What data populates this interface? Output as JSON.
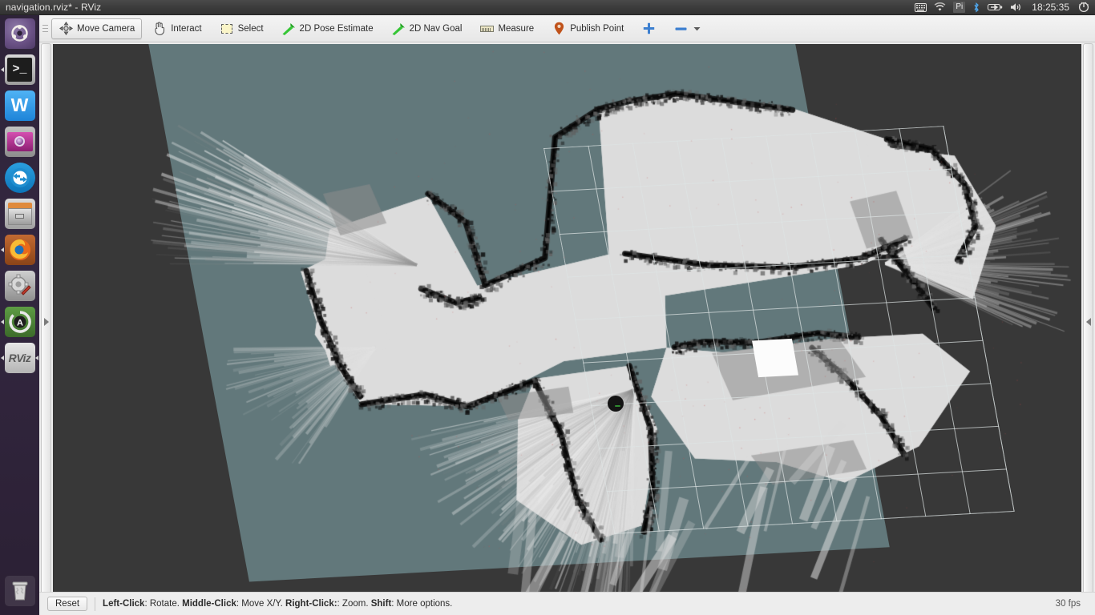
{
  "window": {
    "title": "navigation.rviz* - RViz"
  },
  "top_panel": {
    "tray": [
      {
        "name": "keyboard-indicator-icon",
        "glyph": "keyboard"
      },
      {
        "name": "wifi-icon",
        "glyph": "wifi"
      },
      {
        "name": "keyboard-layout-indicator",
        "label": "Pi"
      },
      {
        "name": "bluetooth-icon",
        "glyph": "bluetooth"
      },
      {
        "name": "battery-icon",
        "glyph": "battery"
      },
      {
        "name": "volume-icon",
        "glyph": "volume"
      }
    ],
    "clock": "18:25:35",
    "session_menu_icon": "power-gear-icon"
  },
  "launcher": {
    "items": [
      {
        "name": "launcher-item-ubuntu-dash",
        "label": "Ubuntu Dash",
        "icon": "ubuntu-logo-icon",
        "running": false
      },
      {
        "name": "launcher-item-terminal",
        "label": "Terminal",
        "icon": "terminal-icon",
        "running": true
      },
      {
        "name": "launcher-item-wps-writer",
        "label": "WPS Writer",
        "icon": "wps-writer-icon",
        "running": false
      },
      {
        "name": "launcher-item-media",
        "label": "Media Player",
        "icon": "media-player-icon",
        "running": false
      },
      {
        "name": "launcher-item-teamviewer",
        "label": "TeamViewer",
        "icon": "teamviewer-icon",
        "running": false
      },
      {
        "name": "launcher-item-files",
        "label": "Files",
        "icon": "file-manager-icon",
        "running": false
      },
      {
        "name": "launcher-item-firefox",
        "label": "Firefox",
        "icon": "firefox-icon",
        "running": true
      },
      {
        "name": "launcher-item-settings",
        "label": "System Settings",
        "icon": "gear-wrench-icon",
        "running": false
      },
      {
        "name": "launcher-item-software-updater",
        "label": "Software Updater",
        "icon": "software-updater-icon",
        "running": true
      },
      {
        "name": "launcher-item-rviz",
        "label": "RViz",
        "icon": "rviz-icon",
        "running": true
      }
    ],
    "trash": {
      "name": "launcher-item-trash",
      "label": "Trash",
      "icon": "trash-icon"
    }
  },
  "toolbar": {
    "tools": [
      {
        "name": "tool-move-camera",
        "label": "Move Camera",
        "icon": "move-camera-icon",
        "active": true
      },
      {
        "name": "tool-interact",
        "label": "Interact",
        "icon": "hand-pointer-icon",
        "active": false
      },
      {
        "name": "tool-select",
        "label": "Select",
        "icon": "selection-box-icon",
        "active": false
      },
      {
        "name": "tool-2d-pose-estimate",
        "label": "2D Pose Estimate",
        "icon": "green-arrow-icon",
        "active": false
      },
      {
        "name": "tool-2d-nav-goal",
        "label": "2D Nav Goal",
        "icon": "green-arrow-icon",
        "active": false
      },
      {
        "name": "tool-measure",
        "label": "Measure",
        "icon": "ruler-icon",
        "active": false
      },
      {
        "name": "tool-publish-point",
        "label": "Publish Point",
        "icon": "map-pin-icon",
        "active": false
      }
    ],
    "add_tool": {
      "name": "add-tool-button",
      "icon": "plus-icon"
    },
    "remove_tool": {
      "name": "remove-tool-button",
      "icon": "minus-icon"
    },
    "remove_tool_menu": {
      "name": "remove-tool-dropdown",
      "icon": "chevron-down-icon"
    }
  },
  "panels": {
    "left_collapsed": {
      "name": "displays-panel-expander",
      "icon": "triangle-right-icon"
    },
    "right_collapsed": {
      "name": "views-panel-expander",
      "icon": "triangle-left-icon"
    }
  },
  "viewport": {
    "name": "render-view-3d",
    "background_color": "#383838",
    "map_plane_color": "#62787b",
    "grid_color": "#dee4e4",
    "free_space_color": "#d6d6d6",
    "obstacle_color": "#141414",
    "robot_marker_color": "#141414",
    "robot_heading_color": "#2f8a2f",
    "costmap_patch_color": "#fcfcfc"
  },
  "statusbar": {
    "reset_label": "Reset",
    "hint_segments": [
      {
        "text": "Left-Click",
        "bold": true
      },
      {
        "text": ": Rotate.  ",
        "bold": false
      },
      {
        "text": "Middle-Click",
        "bold": true
      },
      {
        "text": ": Move X/Y.  ",
        "bold": false
      },
      {
        "text": "Right-Click:",
        "bold": true
      },
      {
        "text": ": Zoom.  ",
        "bold": false
      },
      {
        "text": "Shift",
        "bold": true
      },
      {
        "text": ": More options.",
        "bold": false
      }
    ],
    "fps": "30 fps"
  }
}
